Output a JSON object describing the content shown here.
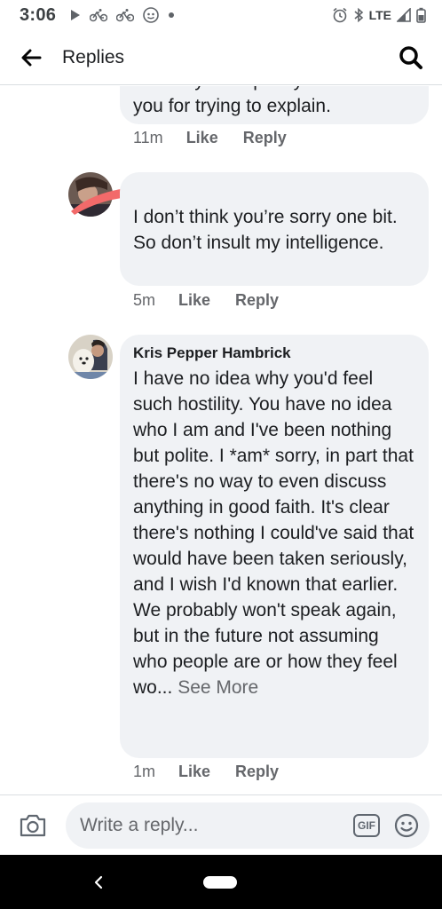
{
  "status_bar": {
    "time": "3:06",
    "network": "LTE"
  },
  "header": {
    "title": "Replies"
  },
  "comments": [
    {
      "text_partial": "I'm sorry I've upset you. Thank",
      "text": "you for trying to explain.",
      "time": "11m",
      "like": "Like",
      "reply": "Reply"
    },
    {
      "author": "",
      "text": "I don’t think you’re sorry one bit. So don’t insult my intelligence.",
      "time": "5m",
      "like": "Like",
      "reply": "Reply"
    },
    {
      "author": "Kris Pepper Hambrick",
      "text": "I have no idea why you'd feel such hostility. You have no idea who I am and I've been nothing but polite. I *am* sorry, in part that there's no way to even discuss anything in good faith. It's clear there's nothing I could've said that would have been taken seriously, and I wish I'd known that earlier. We probably won't speak again, but in the future not assuming who people are or how they feel wo... ",
      "see_more": "See More",
      "time": "1m",
      "like": "Like",
      "reply": "Reply"
    }
  ],
  "composer": {
    "placeholder": "Write a reply...",
    "gif_label": "GIF"
  },
  "colors": {
    "bubble": "#f0f2f5",
    "redaction": "#f26a6a",
    "meta": "#65676b"
  }
}
